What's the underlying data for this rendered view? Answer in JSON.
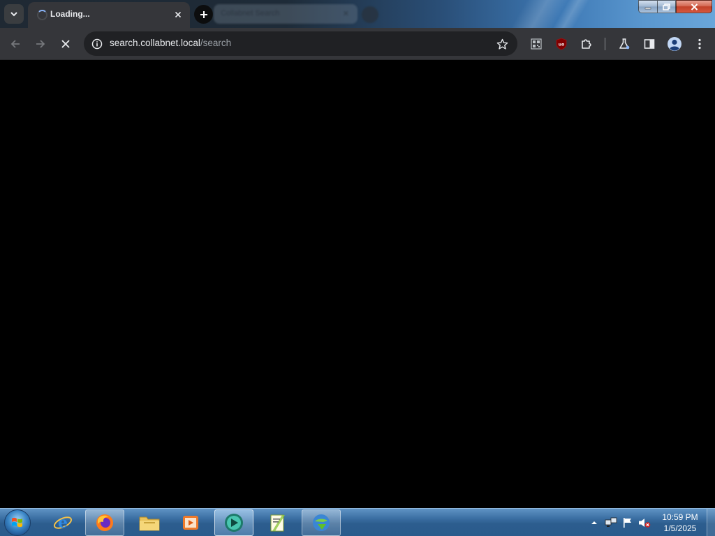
{
  "browser": {
    "active_tab": {
      "title": "Loading..."
    },
    "background_tab": {
      "title": "Collabnet Search"
    },
    "address_bar": {
      "host": "search.collabnet.local",
      "path": "/search"
    }
  },
  "icons": {
    "tab_search": "chevron-down-icon",
    "tab_close": "close-icon",
    "new_tab": "plus-icon",
    "back": "arrow-left-icon",
    "forward": "arrow-right-icon",
    "stop": "close-icon",
    "site_info": "info-icon",
    "bookmark": "star-icon",
    "qr_extension": "qr-code-icon",
    "ublock_extension": "ublock-icon",
    "extensions": "puzzle-icon",
    "labs": "flask-icon",
    "side_panel": "side-panel-icon",
    "profile": "profile-icon",
    "menu": "kebab-menu-icon"
  },
  "ublock_badge": "uo",
  "taskbar": {
    "apps": [
      "internet-explorer-icon",
      "firefox-icon",
      "file-explorer-icon",
      "media-player-icon",
      "chrome-window-icon",
      "notepad-plus-plus-icon",
      "download-manager-icon"
    ],
    "clock": {
      "time": "10:59 PM",
      "date": "1/5/2025"
    }
  },
  "colors": {
    "toolbar_bg": "#35363a",
    "omnibox_bg": "#202124",
    "content_bg": "#000000",
    "accent_blue": "#8ab4f8"
  }
}
